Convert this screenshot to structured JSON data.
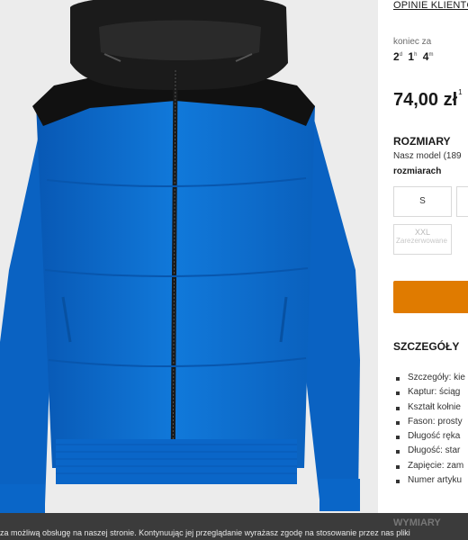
{
  "header": {
    "reviews_link": "OPINIE KLIENTÓ"
  },
  "promo": {
    "timer_label": "koniec za",
    "days": "2",
    "days_unit": "d",
    "hours": "1",
    "hours_unit": "h",
    "minutes": "4",
    "minutes_unit": "m"
  },
  "price": {
    "amount": "74,00 zł",
    "footnote": "1"
  },
  "sizes": {
    "heading": "ROZMIARY",
    "model_note": "Nasz model (189",
    "model_note_bold": "rozmiarach",
    "options": [
      {
        "label": "S"
      },
      {
        "label": "XXL",
        "status": "Zarezerwowane"
      }
    ]
  },
  "details": {
    "heading": "SZCZEGÓŁY",
    "items": [
      "Szczegóły: kie",
      "Kaptur: ściąg",
      "Kształt kołnie",
      "Fason: prosty",
      "Długość ręka",
      "Długość: star",
      "Zapięcie: zam",
      "Numer artyku"
    ]
  },
  "next_section": {
    "heading": "WYMIARY"
  },
  "cookie": {
    "text": "za możliwą obsługę na naszej stronie. Kontynuując jej przeglądanie wyrażasz zgodę na stosowanie przez nas pliki"
  },
  "colors": {
    "jacket": "#0a6fd0",
    "accent": "#e07b00",
    "cookie_bg": "#3b3b3b"
  }
}
